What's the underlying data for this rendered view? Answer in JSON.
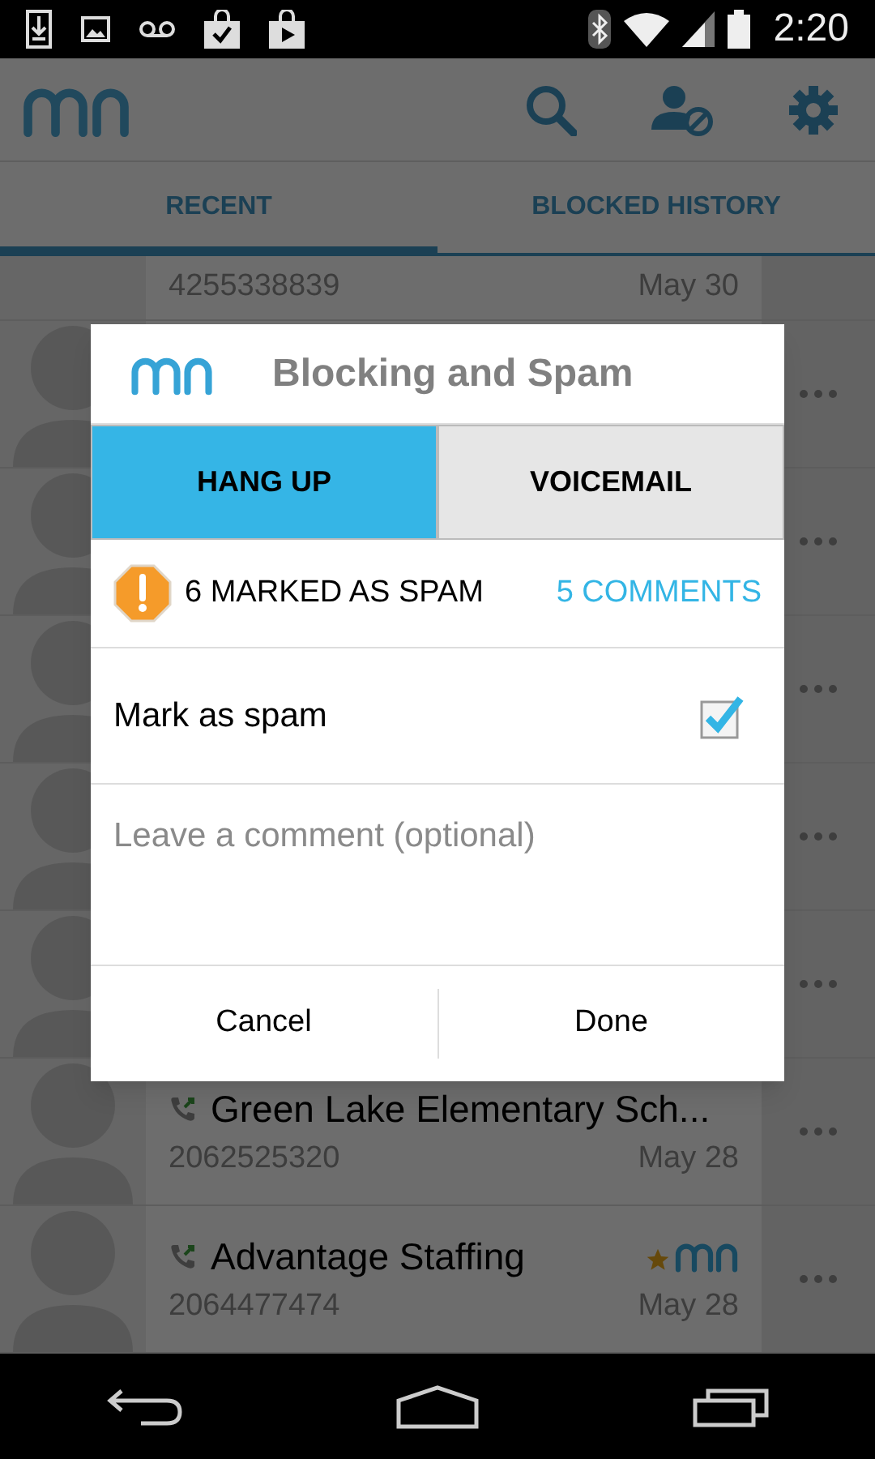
{
  "status_bar": {
    "time": "2:20"
  },
  "tabs": [
    {
      "label": "RECENT",
      "selected": true
    },
    {
      "label": "BLOCKED HISTORY",
      "selected": false
    }
  ],
  "calls": [
    {
      "kind": "partial",
      "number": "4255338839",
      "date": "May 30"
    },
    {
      "kind": "covered"
    },
    {
      "kind": "covered"
    },
    {
      "kind": "covered"
    },
    {
      "kind": "covered"
    },
    {
      "kind": "covered"
    },
    {
      "kind": "entry",
      "name": "Green Lake Elementary Sch...",
      "number": "2062525320",
      "date": "May 28",
      "starred": false
    },
    {
      "kind": "entry",
      "name": "Advantage Staffing",
      "number": "2064477474",
      "date": "May 28",
      "starred": true
    }
  ],
  "dialog": {
    "title": "Blocking and Spam",
    "actions": [
      {
        "label": "HANG UP",
        "selected": true
      },
      {
        "label": "VOICEMAIL",
        "selected": false
      }
    ],
    "spam_count": "6 MARKED AS SPAM",
    "comments_link": "5 COMMENTS",
    "mark_as_spam": {
      "label": "Mark as spam",
      "checked": true
    },
    "comment": {
      "placeholder": "Leave a comment (optional)"
    },
    "buttons": [
      "Cancel",
      "Done"
    ]
  }
}
